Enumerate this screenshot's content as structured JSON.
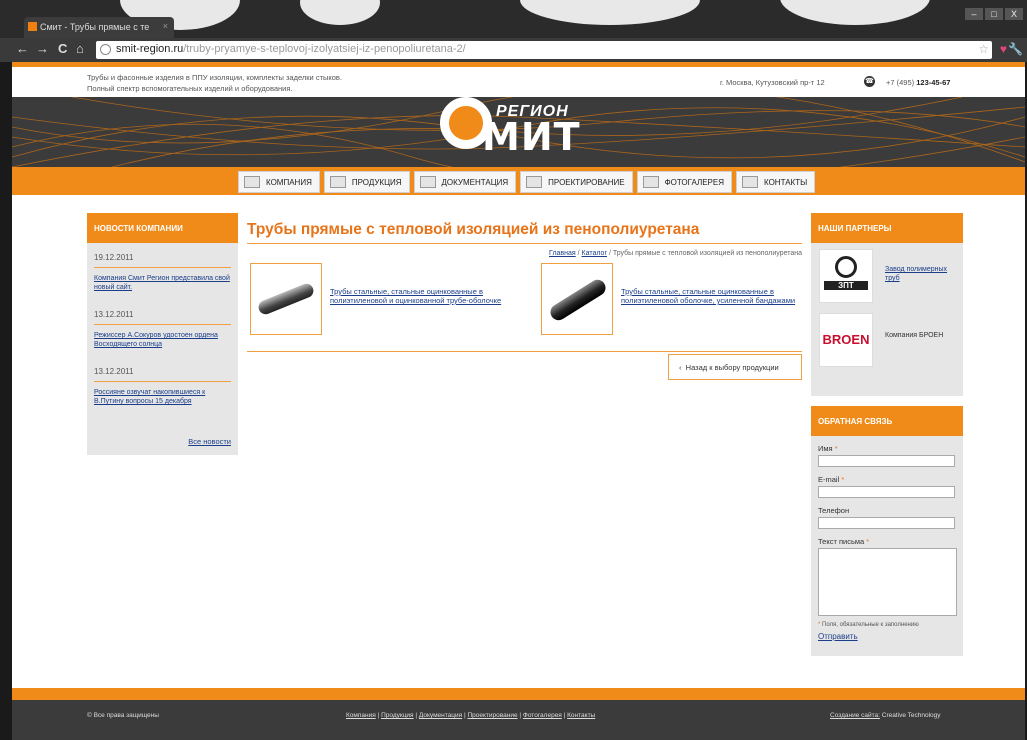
{
  "browser": {
    "tab_title": "Смит - Трубы прямые с те",
    "url_host": "smit-region.ru",
    "url_path": "/truby-pryamye-s-teplovoj-izolyatsiej-iz-penopoliuretana-2/",
    "back_label": "←",
    "forward_label": "→",
    "reload_label": "C",
    "home_label": "⌂",
    "star_label": "☆",
    "heart_label": "♥",
    "wrench_label": "🔧",
    "tab_close_label": "×",
    "win_minimize": "–",
    "win_maximize": "□",
    "win_close": "X"
  },
  "header": {
    "tagline_1": "Трубы и фасонные изделия в ППУ изоляции, комплекты заделки стыков.",
    "tagline_2": "Полный спектр вспомогательных изделий и оборудования.",
    "address": "г. Москва, Кутузовский пр-т 12",
    "phone_prefix": "+7 (495)",
    "phone_number": "123-45-67",
    "logo_top": "РЕГИОН",
    "logo_main": "МИТ"
  },
  "menu": [
    {
      "label": "КОМПАНИЯ",
      "icon": "building-icon"
    },
    {
      "label": "ПРОДУКЦИЯ",
      "icon": "pipes-icon"
    },
    {
      "label": "ДОКУМЕНТАЦИЯ",
      "icon": "document-icon"
    },
    {
      "label": "ПРОЕКТИРОВАНИЕ",
      "icon": "blueprint-icon"
    },
    {
      "label": "ФОТОГАЛЕРЕЯ",
      "icon": "camera-icon"
    },
    {
      "label": "КОНТАКТЫ",
      "icon": "contacts-icon"
    }
  ],
  "news": {
    "title": "НОВОСТИ КОМПАНИИ",
    "items": [
      {
        "date": "19.12.2011",
        "text": "Компания Смит Регион представила свой новый сайт."
      },
      {
        "date": "13.12.2011",
        "text": "Режиссер А.Сокуров удостоен ордена Восходящего солнца"
      },
      {
        "date": "13.12.2011",
        "text": "Россияне озвучат накопившиеся к В.Путину вопросы 15 декабря"
      }
    ],
    "all_label": "Все новости"
  },
  "main": {
    "title": "Трубы прямые с тепловой изоляцией из пенополиуретана",
    "breadcrumb_home": "Главная",
    "breadcrumb_sep": " / ",
    "breadcrumb_catalog": "Каталог",
    "breadcrumb_current": "Трубы прямые с тепловой изоляцией из пенополиуретана",
    "products": [
      {
        "label": "Трубы стальные, стальные оцинкованные в полиэтиленовой и оцинкованной трубе-оболочке"
      },
      {
        "label": "Трубы стальные, стальные оцинкованные в полиэтиленовой оболочке, усиленной бандажами"
      }
    ],
    "back_label": "Назад к выбору продукции",
    "back_icon": "‹"
  },
  "partners": {
    "title": "НАШИ ПАРТНЕРЫ",
    "items": [
      {
        "name": "Завод полимерных труб",
        "logo_text": "ЗПТ"
      },
      {
        "name": "Компания БРОЕН",
        "logo_text": "BROEN"
      }
    ]
  },
  "feedback": {
    "title": "ОБРАТНАЯ СВЯЗЬ",
    "name_label": "Имя",
    "email_label": "E-mail",
    "phone_label": "Телефон",
    "message_label": "Текст письма",
    "required_mark": "*",
    "note": "Поля, обязательные к заполнению",
    "send_label": "Отправить"
  },
  "footer": {
    "copyright": "© Все права защищены",
    "links": [
      "Компания",
      "Продукция",
      "Документация",
      "Проектирование",
      "Фотогалерея",
      "Контакты"
    ],
    "credit_link": "Создание сайта:",
    "credit_text": "Creative Technology"
  },
  "colors": {
    "accent": "#f08a18",
    "title": "#e8741a",
    "link": "#1a3e8a",
    "dark": "#3b3b3b"
  }
}
